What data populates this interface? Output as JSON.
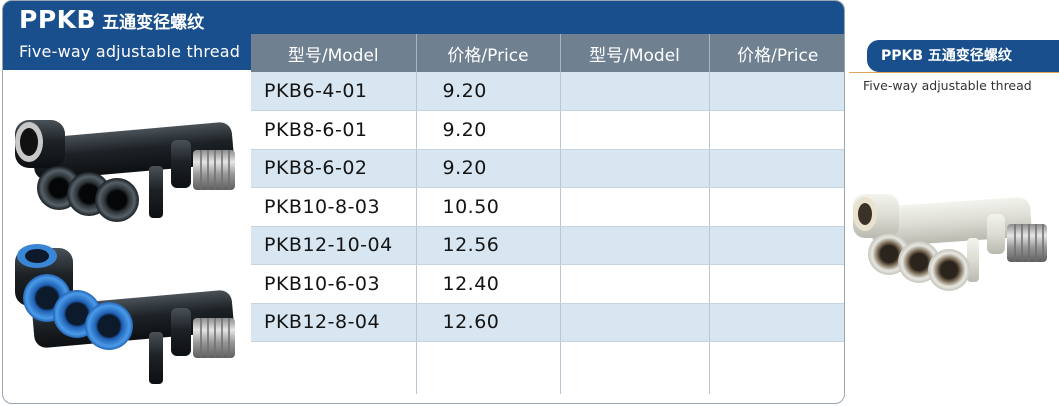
{
  "header": {
    "code": "PPKB",
    "title_cn": "五通变径螺纹",
    "subtitle": "Five-way adjustable thread"
  },
  "table": {
    "columns": [
      "型号/Model",
      "价格/Price",
      "型号/Model",
      "价格/Price"
    ],
    "rows": [
      {
        "model": "PKB6-4-01",
        "price": "9.20"
      },
      {
        "model": "PKB8-6-01",
        "price": "9.20"
      },
      {
        "model": "PKB8-6-02",
        "price": "9.20"
      },
      {
        "model": "PKB10-8-03",
        "price": "10.50"
      },
      {
        "model": "PKB12-10-04",
        "price": "12.56"
      },
      {
        "model": "PKB10-6-03",
        "price": "12.40"
      },
      {
        "model": "PKB12-8-04",
        "price": "12.60"
      }
    ]
  },
  "side": {
    "title": "PPKB 五通变径螺纹",
    "subtitle": "Five-way adjustable thread"
  },
  "colors": {
    "brand_blue": "#1a4f8d",
    "header_gray": "#6f8090",
    "row_stripe": "#d8e6f1",
    "accent_orange": "#e0a75c",
    "fitting_black": "#1d2226",
    "fitting_blue": "#3a86d6",
    "fitting_white": "#e6e6e0",
    "brass_silver": "#b8b8b8"
  },
  "icons": [
    "black-five-way-fitting-image",
    "blue-five-way-fitting-image",
    "white-five-way-fitting-image"
  ]
}
